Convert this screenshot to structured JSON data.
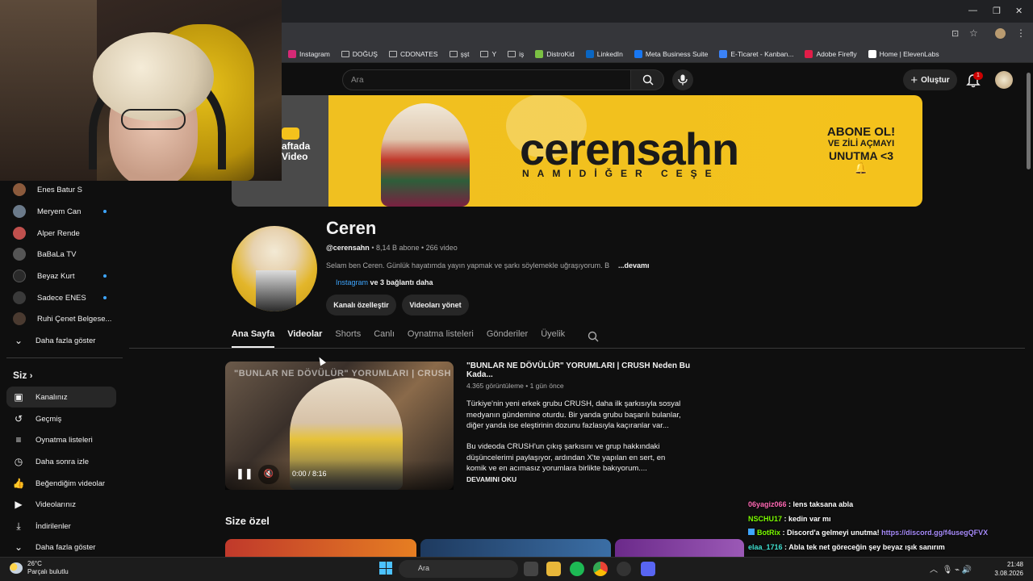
{
  "bookmarks": [
    {
      "label": "Instagram",
      "color": "#d62976"
    },
    {
      "label": "DOĞUŞ",
      "folder": true
    },
    {
      "label": "CDONATES",
      "folder": true
    },
    {
      "label": "şşt",
      "folder": true
    },
    {
      "label": "Y",
      "folder": true
    },
    {
      "label": "iş",
      "folder": true
    },
    {
      "label": "DistroKid",
      "color": "#7bc043"
    },
    {
      "label": "LinkedIn",
      "color": "#0a66c2"
    },
    {
      "label": "Meta Business Suite",
      "color": "#1877f2"
    },
    {
      "label": "E-Ticaret - Kanban...",
      "color": "#3b82f6"
    },
    {
      "label": "Adobe Firefly",
      "color": "#e11d48"
    },
    {
      "label": "Home | ElevenLabs",
      "color": "#ffffff"
    }
  ],
  "header": {
    "search_placeholder": "Ara",
    "create_label": "Oluştur",
    "notif_count": "1"
  },
  "banner": {
    "title": "cerensahn",
    "subtitle": "NAMIDİĞER CEŞE",
    "cta1": "ABONE OL!",
    "cta2": "VE ZİLİ AÇMAYI",
    "cta3": "UNUTMA <3",
    "left_text_1": "aftada",
    "left_text_2": "Video"
  },
  "channel": {
    "name": "Ceren",
    "handle": "@cerensahn",
    "meta": " • 8,14 B abone • 266 video",
    "description": "Selam ben Ceren. Günlük hayatımda yayın yapmak ve şarkı söylemekle uğraşıyorum. B",
    "more": "...devamı",
    "link_main": "Instagram",
    "link_more": " ve 3 bağlantı daha",
    "customize_btn": "Kanalı özelleştir",
    "manage_btn": "Videoları yönet"
  },
  "tabs": [
    "Ana Sayfa",
    "Videolar",
    "Shorts",
    "Canlı",
    "Oynatma listeleri",
    "Gönderiler",
    "Üyelik"
  ],
  "sidebar": {
    "subs": [
      {
        "label": "Enes Batur S",
        "dot": false
      },
      {
        "label": "Meryem Can",
        "dot": true
      },
      {
        "label": "Alper Rende",
        "dot": false
      },
      {
        "label": "BaBaLa TV",
        "dot": false
      },
      {
        "label": "Beyaz Kurt",
        "dot": true
      },
      {
        "label": "Sadece ENES",
        "dot": true
      },
      {
        "label": "Ruhi Çenet Belgese...",
        "dot": false
      },
      {
        "label": "Daha fazla göster",
        "dot": false
      }
    ],
    "you_label": "Siz",
    "you_items": [
      "Kanalınız",
      "Geçmiş",
      "Oynatma listeleri",
      "Daha sonra izle",
      "Beğendiğim videolar",
      "Videolarınız",
      "İndirilenler",
      "Daha fazla göster"
    ]
  },
  "video": {
    "thumb_text": "\"BUNLAR NE DÖVÜLÜR\" YORUMLARI | CRUSH",
    "time": "0:00 / 8:16",
    "title": "\"BUNLAR NE DÖVÜLÜR\" YORUMLARI | CRUSH Neden Bu Kada...",
    "meta": "4.365 görüntüleme • 1 gün önce",
    "desc1": "Türkiye'nin yeni erkek grubu CRUSH, daha ilk şarkısıyla sosyal medyanın gündemine oturdu. Bir yanda grubu başarılı bulanlar, diğer yanda ise eleştirinin dozunu fazlasıyla kaçıranlar var...",
    "desc2": "Bu videoda CRUSH'un çıkış şarkısını ve grup hakkındaki düşüncelerimi paylaşıyor, ardından X'te yapılan en sert, en komik ve en acımasız yorumlara birlikte bakıyorum....",
    "more": "DEVAMINI OKU"
  },
  "section_title": "Size özel",
  "chat": [
    {
      "user": "06yagiz066",
      "color": "#ff69b4",
      "msg": " : lens taksana abla"
    },
    {
      "user": "NSCHU17",
      "color": "#7cfc00",
      "msg": " : kedin var mı"
    },
    {
      "user": "BotRix",
      "color": "#7cfc00",
      "msg": " : Discord'a gelmeyi unutma! ",
      "link": "https://discord.gg/f4usegQFVX"
    },
    {
      "user": "elaa_1716",
      "color": "#40e0d0",
      "msg": " : Abla tek net göreceğin şey beyaz ışık sanırım"
    }
  ],
  "taskbar": {
    "temp": "26°C",
    "weather": "Parçalı bulutlu",
    "search": "Ara",
    "time": "21:48",
    "date": "3.08.2026"
  }
}
